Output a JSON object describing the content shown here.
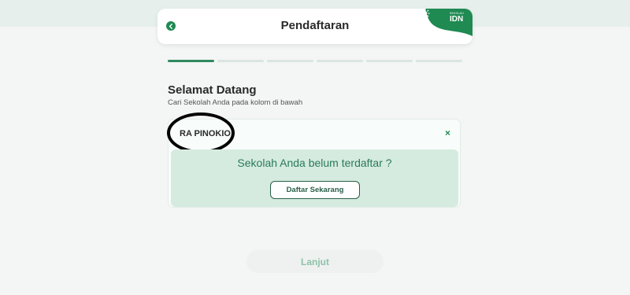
{
  "header": {
    "title": "Pendaftaran",
    "back_icon": "chevron-left-icon",
    "brand": {
      "small_text": "SEKOLAH",
      "text": "IDN",
      "color": "#1f8a52"
    }
  },
  "progress": {
    "total_steps": 6,
    "current_step": 1,
    "active_color": "#2f8a5f",
    "inactive_color": "#d9e6e0"
  },
  "welcome": {
    "title": "Selamat Datang",
    "subtitle": "Cari Sekolah Anda pada kolom di bawah"
  },
  "search": {
    "value": "RA PINOKIO",
    "clear_label": "×"
  },
  "notice": {
    "message": "Sekolah Anda belum terdaftar ?",
    "register_label": "Daftar Sekarang"
  },
  "footer": {
    "next_label": "Lanjut"
  },
  "colors": {
    "accent": "#1f8a52",
    "notice_bg": "#d5ebdf",
    "page_bg": "#f4f5f5"
  }
}
